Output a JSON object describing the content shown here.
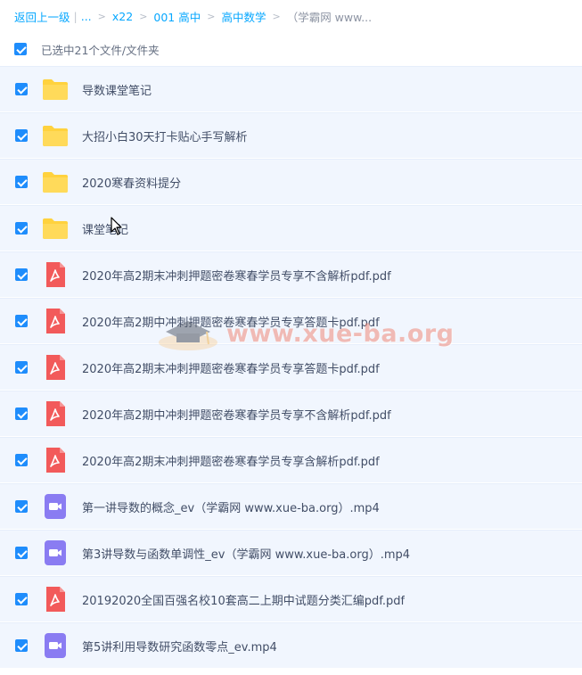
{
  "breadcrumb": {
    "back_label": "返回上一级",
    "ellipsis": "...",
    "items": [
      "x22",
      "001 高中",
      "高中数学"
    ],
    "current": "（学霸网 www..."
  },
  "selection": {
    "text": "已选中21个文件/文件夹"
  },
  "files": [
    {
      "name": "导数课堂笔记",
      "type": "folder"
    },
    {
      "name": "大招小白30天打卡贴心手写解析",
      "type": "folder"
    },
    {
      "name": "2020寒春资料提分",
      "type": "folder"
    },
    {
      "name": "课堂笔记",
      "type": "folder"
    },
    {
      "name": "2020年高2期末冲刺押题密卷寒春学员专享不含解析pdf.pdf",
      "type": "pdf"
    },
    {
      "name": "2020年高2期中冲刺押题密卷寒春学员专享答题卡pdf.pdf",
      "type": "pdf"
    },
    {
      "name": "2020年高2期末冲刺押题密卷寒春学员专享答题卡pdf.pdf",
      "type": "pdf"
    },
    {
      "name": "2020年高2期中冲刺押题密卷寒春学员专享不含解析pdf.pdf",
      "type": "pdf"
    },
    {
      "name": "2020年高2期末冲刺押题密卷寒春学员专享含解析pdf.pdf",
      "type": "pdf"
    },
    {
      "name": "第一讲导数的概念_ev（学霸网 www.xue-ba.org）.mp4",
      "type": "video"
    },
    {
      "name": "第3讲导数与函数单调性_ev（学霸网 www.xue-ba.org）.mp4",
      "type": "video"
    },
    {
      "name": "20192020全国百强名校10套高二上期中试题分类汇编pdf.pdf",
      "type": "pdf"
    },
    {
      "name": "第5讲利用导数研究函数零点_ev.mp4",
      "type": "video"
    }
  ],
  "watermark": {
    "text": "www.xue-ba.org"
  },
  "colors": {
    "accent": "#06a7ff",
    "checkbox": "#1f8dfc",
    "row_bg": "#f1f6fe",
    "folder": "#ffd23e",
    "pdf": "#f25a5a",
    "video": "#8a7cf2"
  }
}
